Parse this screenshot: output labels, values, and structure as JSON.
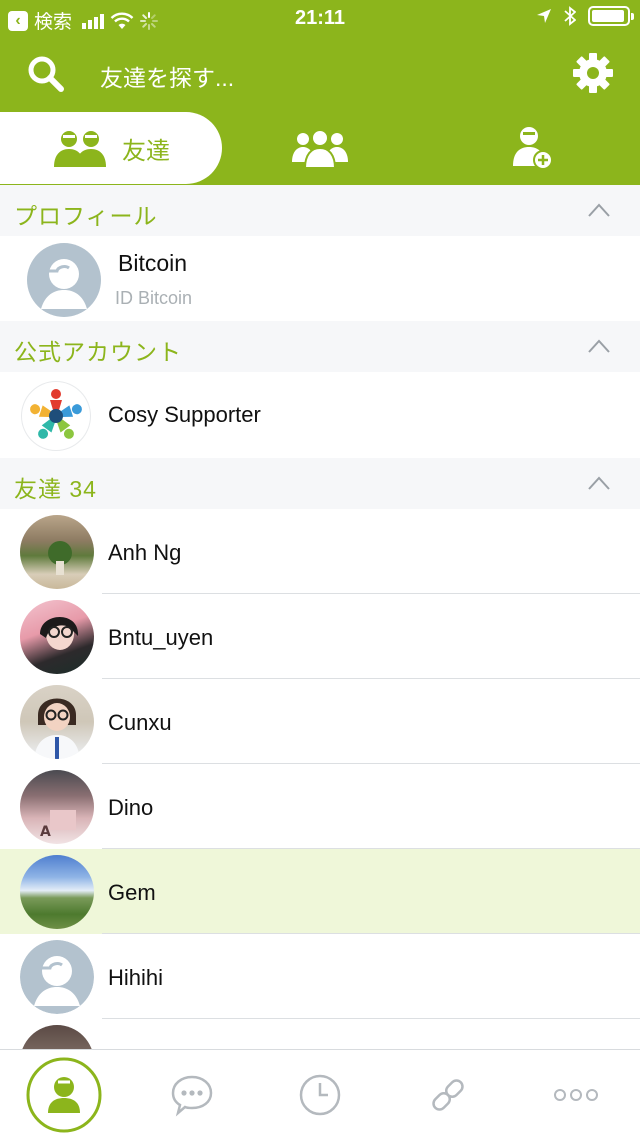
{
  "status_bar": {
    "back_app": "検索",
    "time": "21:11",
    "battery_level_percent": 95
  },
  "header": {
    "search_placeholder": "友達を探す..."
  },
  "tabs": {
    "friends_label": "友達"
  },
  "sections": {
    "profile": {
      "title": "プロフィール",
      "name": "Bitcoin",
      "id_text": "ID Bitcoin"
    },
    "official": {
      "title": "公式アカウント",
      "name": "Cosy Supporter"
    },
    "friends": {
      "title": "友達 34",
      "items": [
        {
          "name": "Anh Ng"
        },
        {
          "name": "Bntu_uyen"
        },
        {
          "name": "Cunxu"
        },
        {
          "name": "Dino"
        },
        {
          "name": "Gem"
        },
        {
          "name": "Hihihi"
        }
      ]
    }
  },
  "colors": {
    "brand": "#8cb51c",
    "highlight_row": "#eff7d9",
    "section_bg": "#f6f7f9"
  },
  "bottom_nav": {
    "icons": [
      "contacts-icon",
      "chat-icon",
      "clock-icon",
      "link-icon",
      "more-icon"
    ]
  }
}
